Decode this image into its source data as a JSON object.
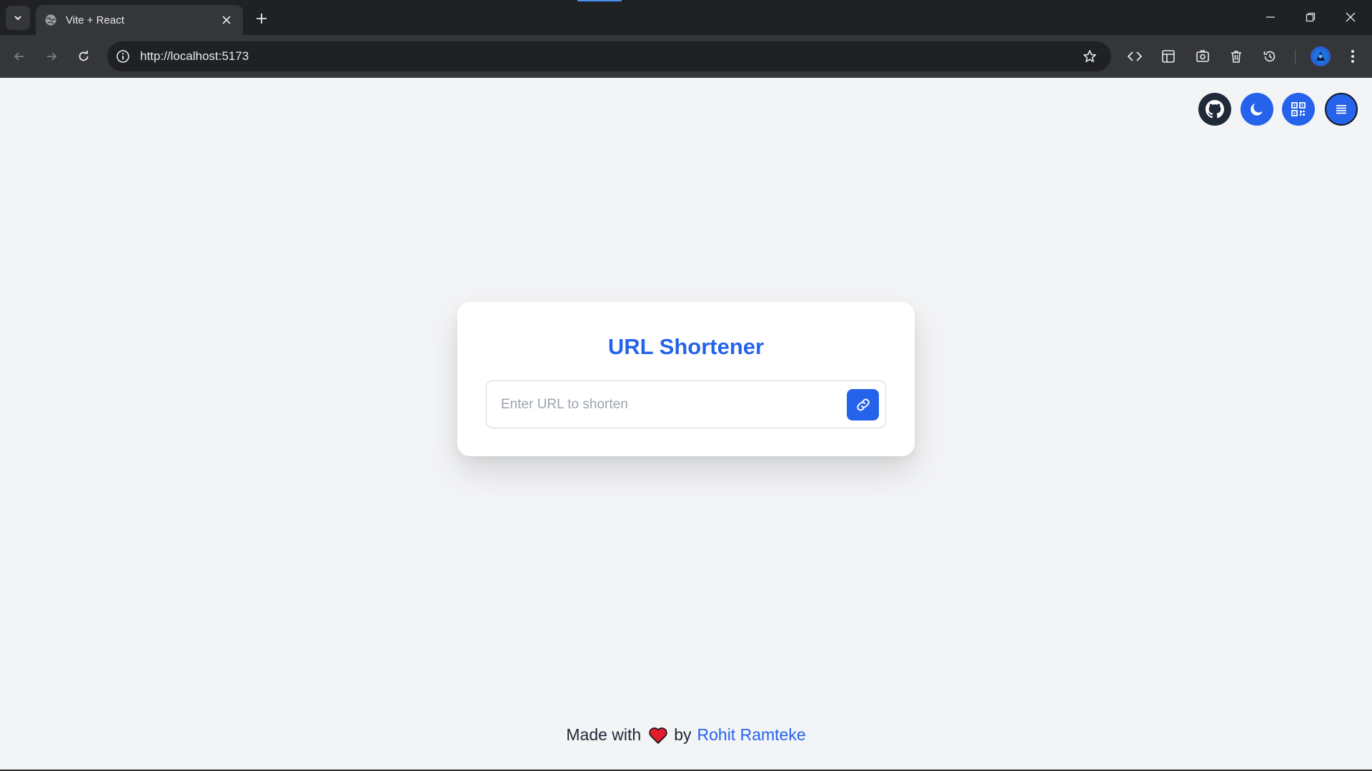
{
  "browser": {
    "tab_title": "Vite + React",
    "url": "http://localhost:5173"
  },
  "page": {
    "title": "URL Shortener",
    "input_placeholder": "Enter URL to shorten",
    "footer": {
      "made_with": "Made with",
      "by": "by",
      "author": "Rohit Ramteke"
    },
    "header_buttons": [
      "github-icon",
      "moon-icon",
      "qr-code-icon",
      "menu-icon"
    ]
  },
  "colors": {
    "accent": "#2563eb",
    "page_bg": "#f3f4f6",
    "github_button": "#1f2937",
    "heart": "#e11d2e"
  }
}
